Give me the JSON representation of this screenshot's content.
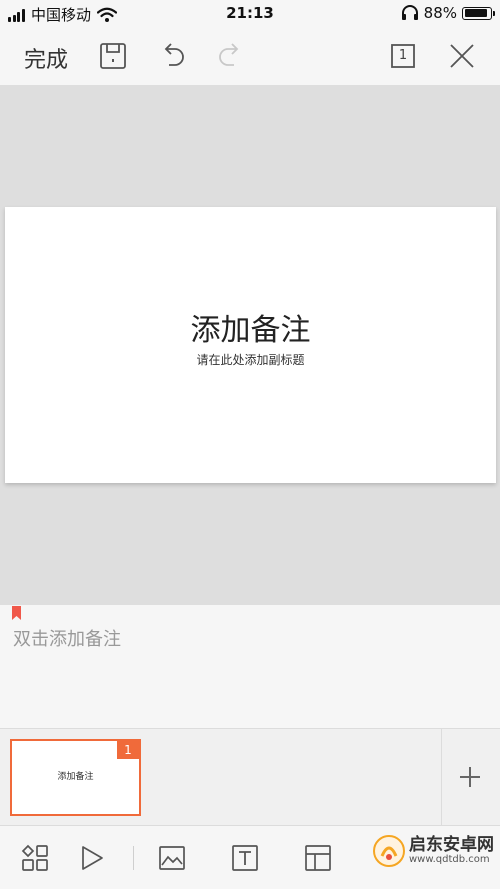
{
  "status_bar": {
    "carrier": "中国移动",
    "time": "21:13",
    "battery_percent": "88%",
    "battery_level": 0.88,
    "icons": [
      "signal-icon",
      "wifi-icon",
      "headphones-icon",
      "battery-icon"
    ]
  },
  "toolbar": {
    "done_label": "完成",
    "page_indicator": "1",
    "icons": [
      "save-icon",
      "undo-icon",
      "redo-icon",
      "page-count-icon",
      "close-icon"
    ]
  },
  "slide": {
    "title": "添加备注",
    "subtitle": "请在此处添加副标题"
  },
  "notes": {
    "placeholder": "双击添加备注"
  },
  "thumbnails": [
    {
      "number": "1",
      "title": "添加备注"
    }
  ],
  "bottom_toolbar": {
    "icons": [
      "layout-grid-icon",
      "play-icon",
      "insert-image-icon",
      "text-box-icon",
      "slide-layout-icon"
    ]
  },
  "watermark": {
    "name": "启东安卓网",
    "url": "www.qdtdb.com"
  },
  "colors": {
    "accent": "#f06a3a",
    "canvas_bg": "#dedede",
    "placeholder_text": "#999999"
  }
}
